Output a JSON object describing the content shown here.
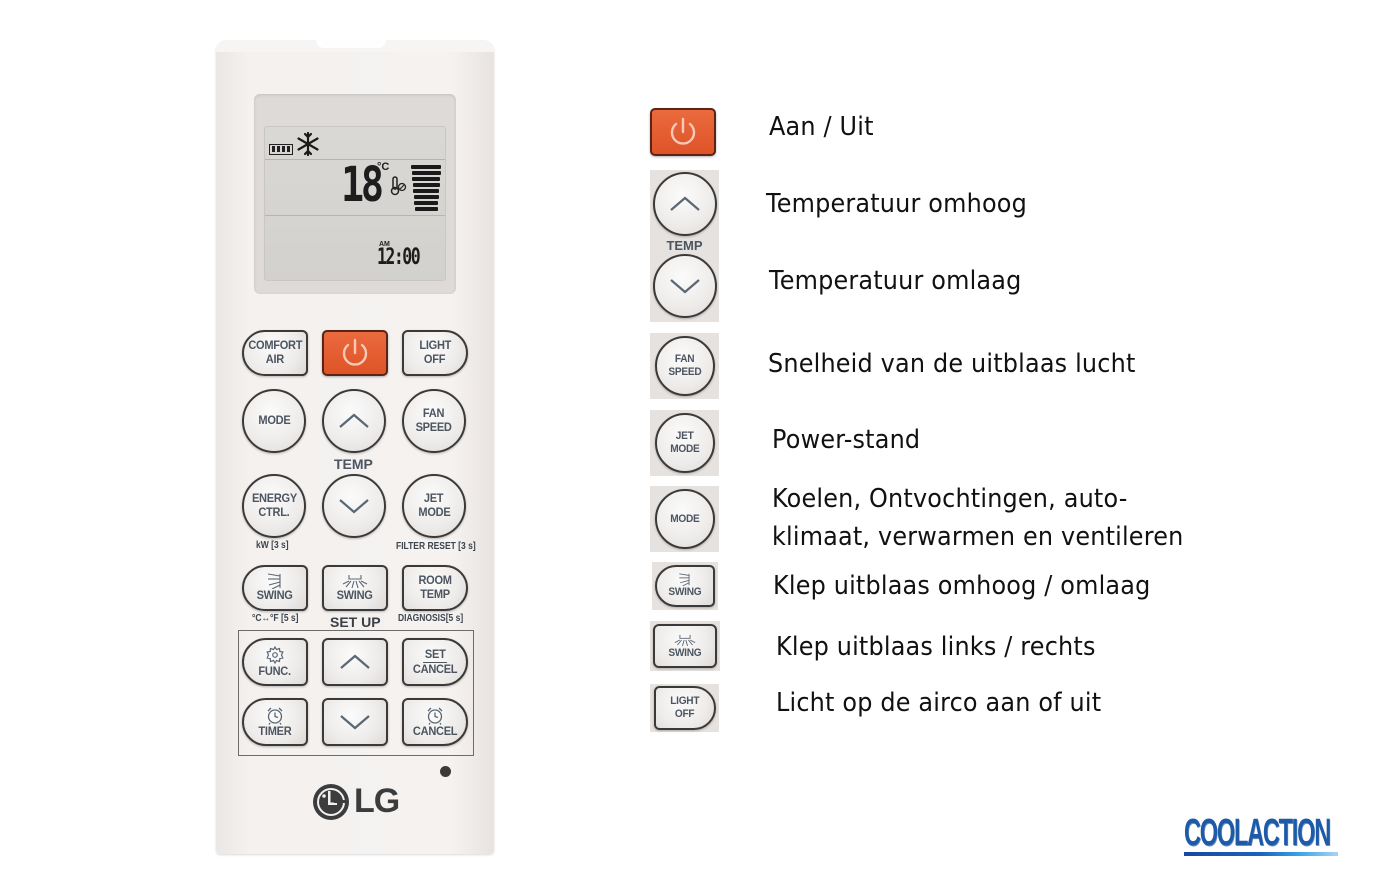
{
  "remote": {
    "brand": "LG",
    "lcd": {
      "temperature": "18",
      "unit": "°C",
      "clock_period": "AM",
      "clock": "12:00",
      "mode_icon": "snowflake-icon",
      "battery_icon": "battery-icon",
      "fan_level_bars": 8
    },
    "buttons": {
      "comfort_air": [
        "COMFORT",
        "AIR"
      ],
      "power_icon": "power-icon",
      "light_off": [
        "LIGHT",
        "OFF"
      ],
      "mode": [
        "MODE"
      ],
      "temp_up_icon": "chevron-up-icon",
      "fan_speed": [
        "FAN",
        "SPEED"
      ],
      "temp_label": "TEMP",
      "energy_ctrl": [
        "ENERGY",
        "CTRL."
      ],
      "temp_down_icon": "chevron-down-icon",
      "jet_mode": [
        "JET",
        "MODE"
      ],
      "energy_sub": "kW [3 s]",
      "jet_sub": "FILTER RESET [3 s]",
      "swing_vertical": "SWING",
      "swing_horizontal": "SWING",
      "room_temp": [
        "ROOM",
        "TEMP"
      ],
      "swing_sub": "°C↔°F [5 s]",
      "setup_label": "SET UP",
      "room_temp_sub": "DIAGNOSIS[5 s]",
      "func": "FUNC.",
      "setup_up_icon": "chevron-up-icon",
      "set_cancel": [
        "SET",
        "CANCEL"
      ],
      "timer": "TIMER",
      "setup_down_icon": "chevron-down-icon",
      "cancel": "CANCEL"
    }
  },
  "legend": [
    {
      "icon": "power-button",
      "text": "Aan / Uit"
    },
    {
      "icon": "temp-up-button",
      "text": "Temperatuur omhoog",
      "icon_label": "TEMP"
    },
    {
      "icon": "temp-down-button",
      "text": "Temperatuur omlaag"
    },
    {
      "icon": "fan-speed-button",
      "icon_label": [
        "FAN",
        "SPEED"
      ],
      "text": "Snelheid van de uitblaas lucht"
    },
    {
      "icon": "jet-mode-button",
      "icon_label": [
        "JET",
        "MODE"
      ],
      "text": "Power-stand"
    },
    {
      "icon": "mode-button",
      "icon_label": [
        "MODE"
      ],
      "text": [
        "Koelen, Ontvochtingen, auto-",
        "klimaat, verwarmen en ventileren"
      ]
    },
    {
      "icon": "swing-vertical-button",
      "icon_label": "SWING",
      "text": "Klep uitblaas omhoog / omlaag"
    },
    {
      "icon": "swing-horizontal-button",
      "icon_label": "SWING",
      "text": "Klep uitblaas links / rechts"
    },
    {
      "icon": "light-off-button",
      "icon_label": [
        "LIGHT",
        "OFF"
      ],
      "text": "Licht op de airco aan of uit"
    }
  ],
  "branding": {
    "logo_text": "COOLACTION"
  },
  "colors": {
    "power_red": "#e05a2c",
    "button_text": "#4c5560",
    "brand_blue": "#1d5aa8"
  }
}
